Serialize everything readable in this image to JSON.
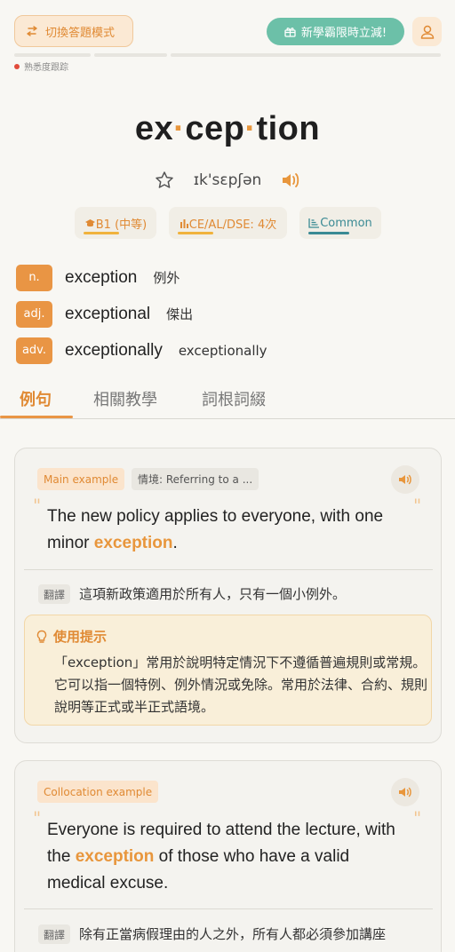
{
  "header": {
    "mode_button_label": "切換答題模式",
    "promo_label": "新學霸限時立減!",
    "progress_label": "熟悉度跟踪",
    "icons": {
      "mode": "swap-arrows-icon",
      "promo": "gift-icon",
      "user": "user-icon"
    }
  },
  "word": {
    "syllables": [
      "ex",
      "cep",
      "tion"
    ],
    "separator": "·",
    "ipa": "ɪk'sɛpʃən"
  },
  "badges": {
    "level": "B1 (中等)",
    "exam": "CE/AL/DSE: 4次",
    "frequency": "Common"
  },
  "forms": [
    {
      "pos": "n.",
      "word": "exception",
      "translation": "例外"
    },
    {
      "pos": "adj.",
      "word": "exceptional",
      "translation": "傑出"
    },
    {
      "pos": "adv.",
      "word": "exceptionally",
      "translation": "exceptionally"
    }
  ],
  "tabs": [
    "例句",
    "相關教學",
    "詞根詞綴"
  ],
  "examples": [
    {
      "type_label": "Main example",
      "context_label": "情境: Referring to a ...",
      "sentence_before": "The new policy applies to everyone, with one minor ",
      "highlight": "exception",
      "sentence_after": ".",
      "translation_tag": "翻譯",
      "translation": "這項新政策適用於所有人，只有一個小例外。",
      "tip_title": "使用提示",
      "tip_body": "「exception」常用於說明特定情況下不遵循普遍規則或常規。它可以指一個特例、例外情況或免除。常用於法律、合約、規則說明等正式或半正式語境。"
    },
    {
      "type_label": "Collocation example",
      "sentence_before": "Everyone is required to attend the lecture, with the ",
      "highlight": "exception",
      "sentence_after": " of those who have a valid medical excuse.",
      "translation_tag": "翻譯",
      "translation": "除有正當病假理由的人之外，所有人都必須參加講座"
    }
  ],
  "colors": {
    "accent": "#e8963c",
    "promo": "#6cc0a8",
    "common": "#3a8a94"
  }
}
